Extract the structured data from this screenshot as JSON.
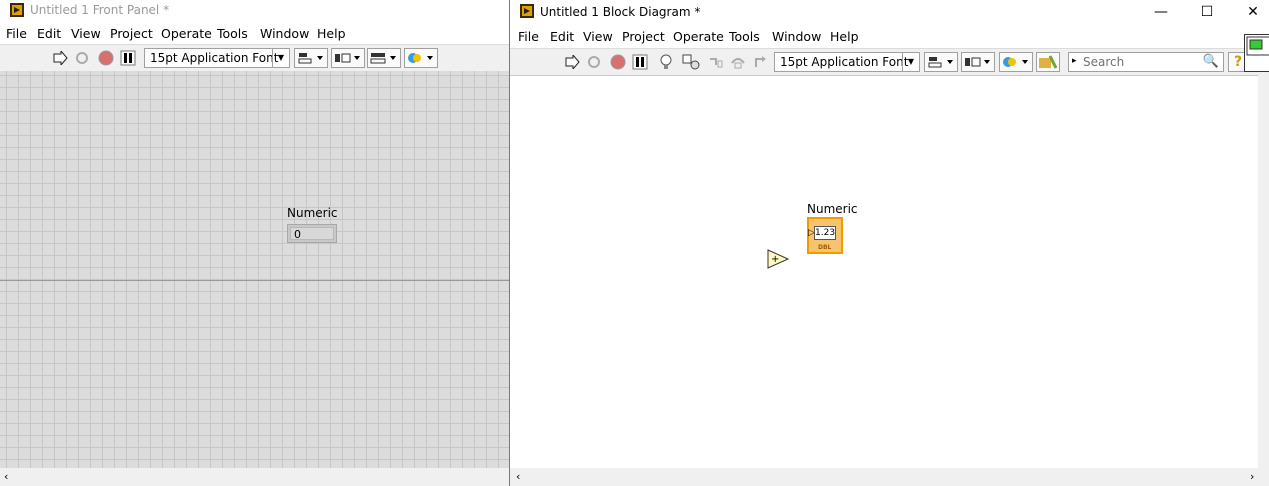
{
  "front_panel": {
    "title": "Untitled 1 Front Panel *",
    "menu": [
      "File",
      "Edit",
      "View",
      "Project",
      "Operate",
      "Tools",
      "Window",
      "Help"
    ],
    "font_select": "15pt Application Font",
    "numeric_label": "Numeric",
    "numeric_value": "0"
  },
  "block_diagram": {
    "title": "Untitled 1 Block Diagram *",
    "menu": [
      "File",
      "Edit",
      "View",
      "Project",
      "Operate",
      "Tools",
      "Window",
      "Help"
    ],
    "font_select": "15pt Application Font",
    "search_placeholder": "Search",
    "numeric_label": "Numeric",
    "terminal_value": "1.23",
    "terminal_type": "DBL",
    "window_controls": {
      "minimize": "—",
      "maximize": "☐",
      "close": "✕"
    }
  },
  "colors": {
    "accent_orange": "#f29b00",
    "grid": "#c6c6c6",
    "panel_bg": "#dcdcdc"
  }
}
